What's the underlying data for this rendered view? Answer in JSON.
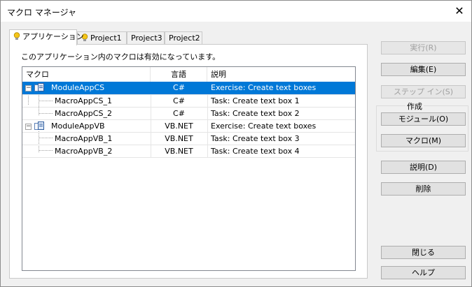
{
  "window": {
    "title": "マクロ マネージャ",
    "close_glyph": "✕"
  },
  "tabs": [
    {
      "label": "アプリケーション",
      "active": true,
      "icon": "bulb-icon"
    },
    {
      "label": "Project1",
      "active": false,
      "icon": "bulb-icon"
    },
    {
      "label": "Project3",
      "active": false
    },
    {
      "label": "Project2",
      "active": false
    }
  ],
  "panel": {
    "hint": "このアプリケーション内のマクロは有効になっています。"
  },
  "table": {
    "headers": {
      "macro": "マクロ",
      "lang": "言語",
      "desc": "説明"
    },
    "rows": [
      {
        "name": "ModuleAppCS",
        "lang": "C#",
        "desc": "Exercise: Create text boxes",
        "level": 0,
        "selected": true
      },
      {
        "name": "MacroAppCS_1",
        "lang": "C#",
        "desc": "Task: Create text box 1",
        "level": 1
      },
      {
        "name": "MacroAppCS_2",
        "lang": "C#",
        "desc": "Task: Create text box 2",
        "level": 1
      },
      {
        "name": "ModuleAppVB",
        "lang": "VB.NET",
        "desc": "Exercise: Create text boxes",
        "level": 0
      },
      {
        "name": "MacroAppVB_1",
        "lang": "VB.NET",
        "desc": "Task: Create text box 3",
        "level": 1
      },
      {
        "name": "MacroAppVB_2",
        "lang": "VB.NET",
        "desc": "Task: Create text box 4",
        "level": 1
      }
    ]
  },
  "buttons": {
    "run": "実行(R)",
    "edit": "編集(E)",
    "step_into": "ステップ イン(S)",
    "create_group": "作成",
    "module": "モジュール(O)",
    "macro": "マクロ(M)",
    "describe": "説明(D)",
    "delete": "削除",
    "close": "閉じる",
    "help": "ヘルプ"
  },
  "colors": {
    "selection": "#0078d7",
    "bulb": "#f5c518"
  }
}
